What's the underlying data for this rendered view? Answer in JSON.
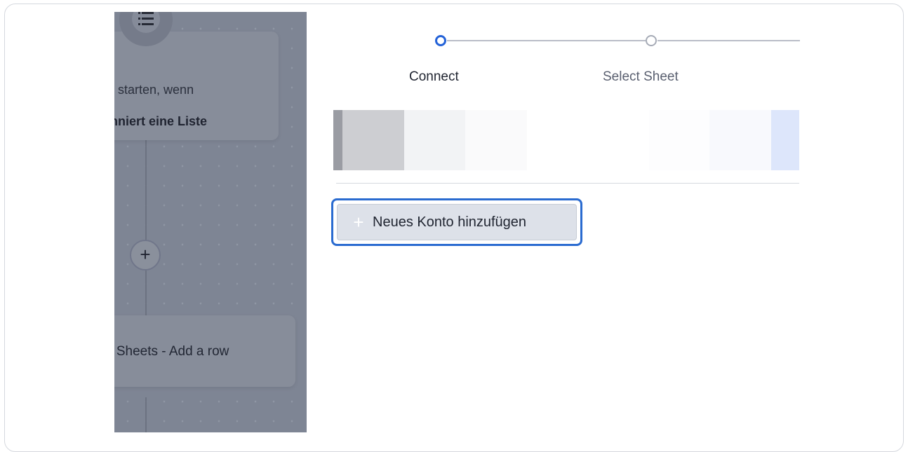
{
  "canvas": {
    "trigger_card": {
      "line1": "ion starten, wenn",
      "line2": "bonniert eine Liste"
    },
    "action_card": {
      "text": "e Sheets - Add a row"
    },
    "add_step_symbol": "+",
    "list_icon_name": "list-icon"
  },
  "stepper": {
    "steps": [
      {
        "label": "Connect",
        "state": "active"
      },
      {
        "label": "Select Sheet",
        "state": "inactive"
      }
    ],
    "colors": {
      "active": "#2563d8",
      "inactive": "#a6abb6",
      "line": "#b9bdc7"
    }
  },
  "swatches": [
    "#9a9ca3",
    "#cdced2",
    "#f2f3f5",
    "#fafafb",
    "#ffffff",
    "#ffffff",
    "#fdfdfe",
    "#f8f9fd",
    "#dde6fb"
  ],
  "account": {
    "add_button_label": "Neues Konto hinzufügen",
    "add_button_icon": "plus-icon",
    "focus_color": "#2a6bd0"
  }
}
